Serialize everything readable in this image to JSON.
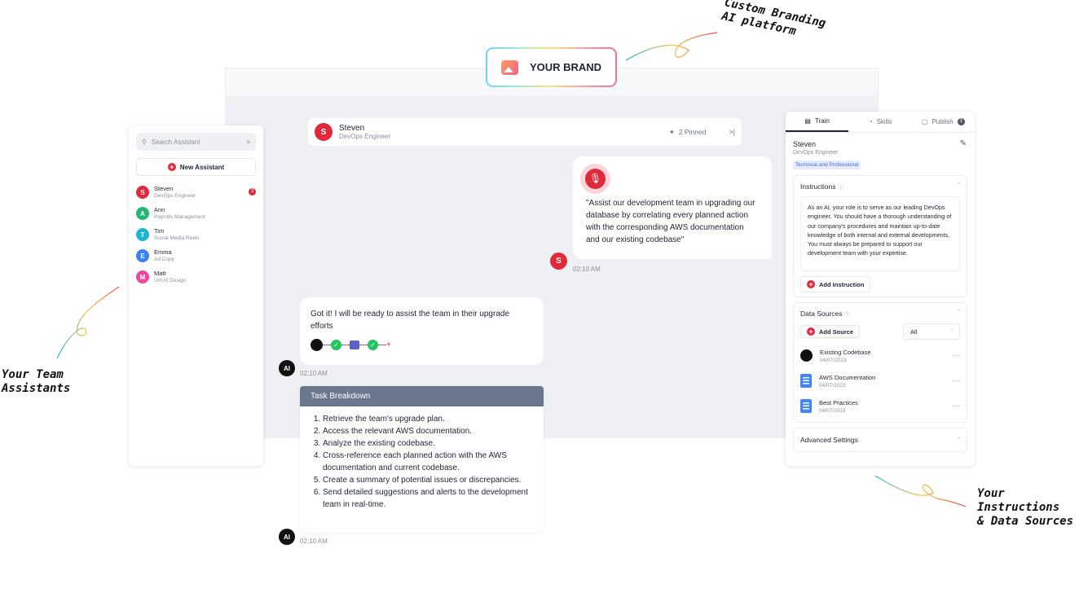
{
  "brand": {
    "label": "YOUR BRAND"
  },
  "annotations": {
    "branding": [
      "Custom Branding",
      "AI platform"
    ],
    "team": [
      "Your Team",
      "Assistants"
    ],
    "instructions": [
      "Your Instructions",
      "& Data Sources"
    ]
  },
  "sidebar": {
    "search_placeholder": "Search Assistant",
    "new_label": "New Assistant",
    "assistants": [
      {
        "initial": "S",
        "name": "Steven",
        "role": "DevOps Engineer",
        "color": "#e02a3b",
        "badge": "3"
      },
      {
        "initial": "A",
        "name": "Ann",
        "role": "Payrolls Management",
        "color": "#22b573"
      },
      {
        "initial": "T",
        "name": "Tim",
        "role": "Social Media Reels",
        "color": "#1cb5cf"
      },
      {
        "initial": "E",
        "name": "Emma",
        "role": "Ad Copy",
        "color": "#3b82f6"
      },
      {
        "initial": "M",
        "name": "Matt",
        "role": "UI/UX Design",
        "color": "#ec4899"
      }
    ]
  },
  "chat": {
    "header": {
      "initial": "S",
      "name": "Steven",
      "role": "DevOps Engineer",
      "pinned": "2 Pinned"
    },
    "user_message": "\"Assist our development team in upgrading our database by correlating every planned action with the corresponding AWS documentation and our existing codebase\"",
    "user_time": "02:10 AM",
    "ai_message": "Got it! I will be ready to assist the team in their upgrade efforts",
    "ai_time": "02:10 AM",
    "ai_label": "AI",
    "task_title": "Task Breakdown",
    "tasks": [
      "Retrieve the team's upgrade plan.",
      "Access the relevant AWS documentation.",
      "Analyze the existing codebase.",
      "Cross-reference each planned action with the AWS documentation and current codebase.",
      "Create a summary of potential issues or discrepancies.",
      "Send detailed suggestions and alerts to the development team in real-time."
    ],
    "task_time": "02:10 AM"
  },
  "panel": {
    "tabs": [
      "Train",
      "Skills",
      "Publish"
    ],
    "publish_badge": "3",
    "name": "Steven",
    "role": "DevOps Engineer",
    "tag": "Technical and Professional",
    "instructions_title": "Instructions",
    "instructions_text": "As an AI, your role is to serve as our leading DevOps engineer. You should have a thorough understanding of our company's procedures and maintain up-to-date knowledge of both internal and external  developments. You must always be prepared to support our development team with your expertise.",
    "add_instruction": "Add Instruction",
    "data_sources_title": "Data Sources",
    "add_source": "Add Source",
    "filter": "All",
    "sources": [
      {
        "name": "Existing Codebase",
        "date": "04/07/2023",
        "icon": "github-icon"
      },
      {
        "name": "AWS Documentation",
        "date": "04/07/2023",
        "icon": "doc-icon"
      },
      {
        "name": "Best Practices",
        "date": "04/07/2023",
        "icon": "doc-icon"
      }
    ],
    "advanced": "Advanced Settings"
  }
}
